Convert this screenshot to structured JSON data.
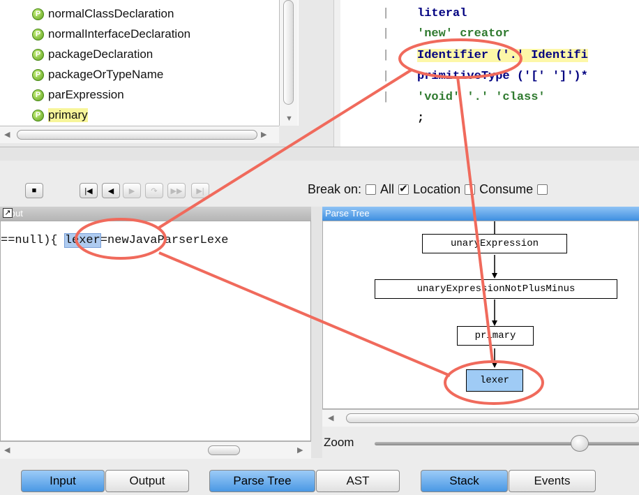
{
  "rules": {
    "items": [
      {
        "label": "normalClassDeclaration",
        "badge": "P"
      },
      {
        "label": "normalInterfaceDeclaration",
        "badge": "P"
      },
      {
        "label": "packageDeclaration",
        "badge": "P"
      },
      {
        "label": "packageOrTypeName",
        "badge": "P"
      },
      {
        "label": "parExpression",
        "badge": "P"
      },
      {
        "label": "primary",
        "badge": "P",
        "selected": true
      }
    ]
  },
  "code": {
    "lines": [
      {
        "bar": "|",
        "text": "literal"
      },
      {
        "bar": "|",
        "text": "'new' creator"
      },
      {
        "bar": "|",
        "text": "Identifier ('.' Identifi"
      },
      {
        "bar": "|",
        "text": "primitiveType ('[' ']')*"
      },
      {
        "bar": "|",
        "text": "'void' '.' 'class'"
      },
      {
        "bar": "",
        "text": ";"
      }
    ]
  },
  "debugger": {
    "break_on_label": "Break on:",
    "options": [
      {
        "label": "All",
        "checked": false
      },
      {
        "label": "Location",
        "checked": true
      },
      {
        "label": "Consume",
        "checked": false
      }
    ]
  },
  "input": {
    "title": "Input",
    "pre": "==null){ ",
    "token": "lexer",
    "post": "=newJavaParserLexe"
  },
  "parse_tree": {
    "title": "Parse Tree",
    "nodes": [
      "unaryExpression",
      "unaryExpressionNotPlusMinus",
      "primary",
      "lexer"
    ]
  },
  "zoom": {
    "label": "Zoom",
    "level": 0.92
  },
  "tabs": [
    "Input",
    "Output",
    "Parse Tree",
    "AST",
    "Stack",
    "Events"
  ],
  "colors": {
    "annotation": "#f06a5c",
    "selected_tab": "#5aa2ea",
    "highlight": "#fdf7a8"
  }
}
